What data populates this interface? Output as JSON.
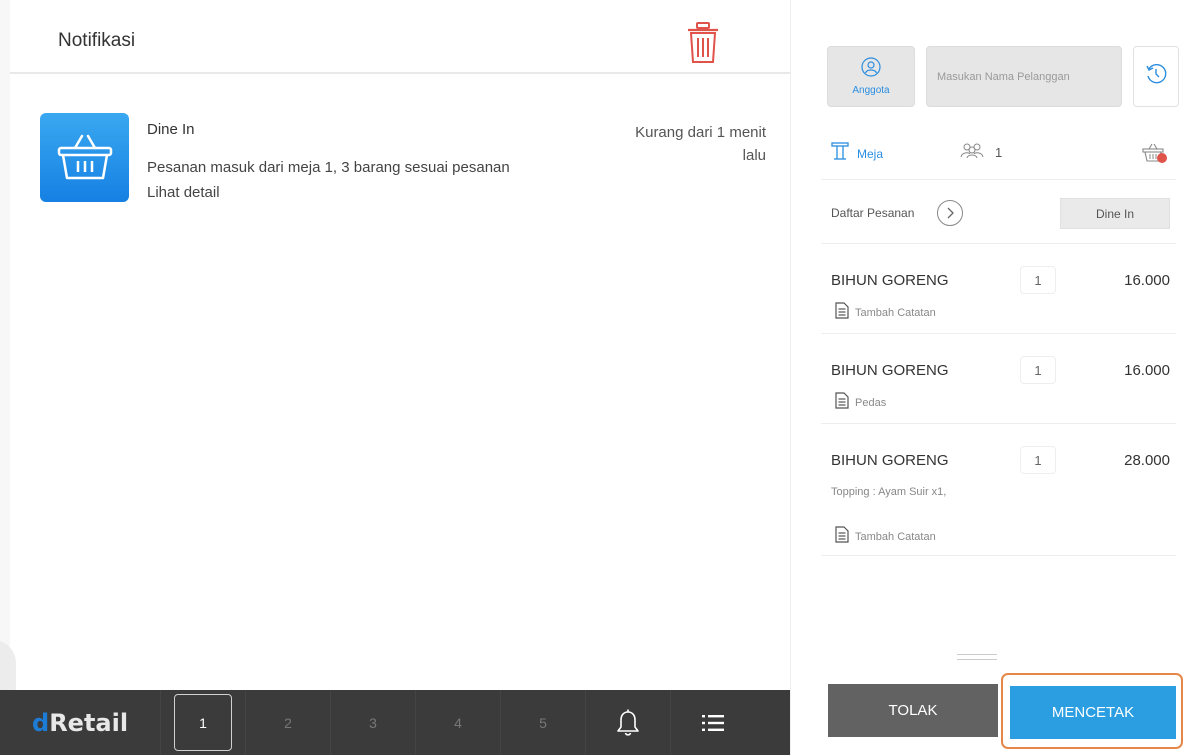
{
  "notifications": {
    "title": "Notifikasi",
    "items": [
      {
        "type": "Dine In",
        "message": "Pesanan masuk dari meja 1, 3 barang sesuai pesanan",
        "link": "Lihat detail",
        "time": "Kurang dari 1 menit lalu"
      }
    ]
  },
  "bottom_bar": {
    "brand_prefix": "d",
    "brand_rest": "Retail",
    "tabs": [
      "1",
      "2",
      "3",
      "4",
      "5"
    ],
    "active_tab": "1"
  },
  "customer": {
    "member_label": "Anggota",
    "name_placeholder": "Masukan Nama Pelanggan"
  },
  "table": {
    "label": "Meja",
    "guests": "1"
  },
  "orders": {
    "header_label": "Daftar Pesanan",
    "type_button": "Dine In",
    "items": [
      {
        "name": "BIHUN GORENG",
        "qty": "1",
        "price": "16.000",
        "topping": "",
        "note": "Tambah Catatan"
      },
      {
        "name": "BIHUN GORENG",
        "qty": "1",
        "price": "16.000",
        "topping": "",
        "note": "Pedas"
      },
      {
        "name": "BIHUN GORENG",
        "qty": "1",
        "price": "28.000",
        "topping": "Topping : Ayam Suir x1,",
        "note": "Tambah Catatan"
      }
    ]
  },
  "actions": {
    "reject": "TOLAK",
    "print": "MENCETAK"
  },
  "colors": {
    "accent_blue": "#2a9ee0",
    "danger_red": "#e0534a",
    "highlight_orange": "#e5874a",
    "bar_dark": "#3b3b3b"
  }
}
